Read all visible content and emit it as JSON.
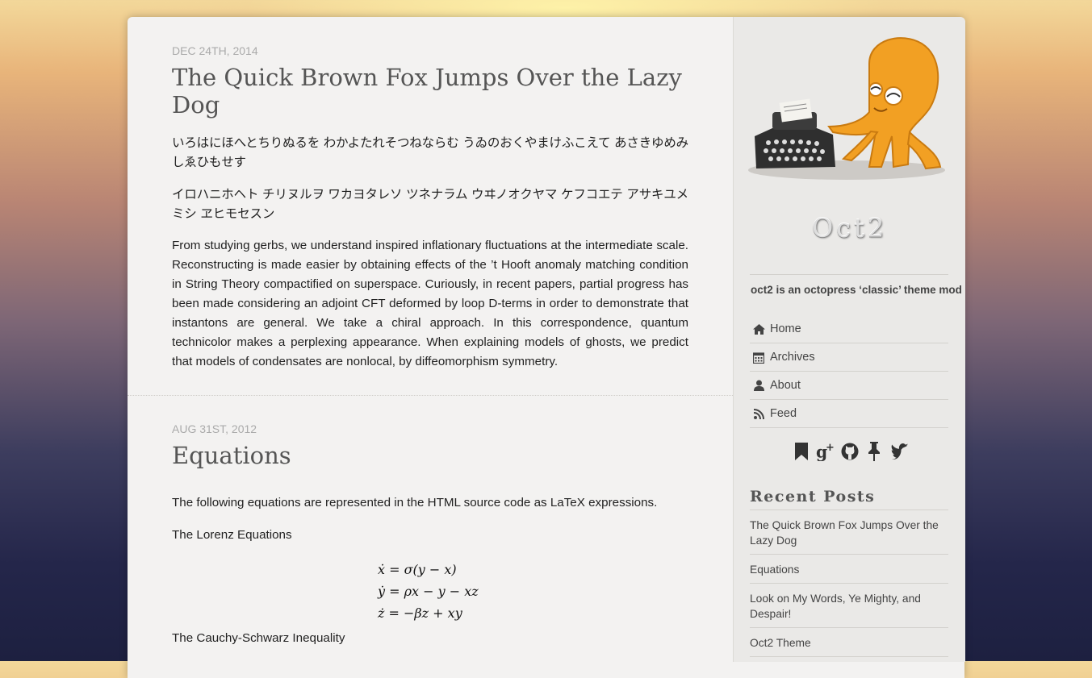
{
  "posts": [
    {
      "date": "Dec 24th, 2014",
      "title": "The Quick Brown Fox Jumps Over the Lazy Dog",
      "paragraphs": [
        "いろはにほへとちりぬるを わかよたれそつねならむ うゐのおくやまけふこえて あさきゆめみしゑひもせす",
        "イロハニホヘト チリヌルヲ ワカヨタレソ ツネナラム ウヰノオクヤマ ケフコエテ アサキユメミシ ヱヒモセスン",
        "From studying gerbs, we understand inspired inflationary fluctuations at the intermediate scale. Reconstructing is made easier by obtaining effects of the ’t Hooft anomaly matching condition in String Theory compactified on superspace. Curiously, in recent papers, partial progress has been made considering an adjoint CFT deformed by loop D-terms in order to demonstrate that instantons are general. We take a chiral approach. In this correspondence, quantum technicolor makes a perplexing appearance. When explaining models of ghosts, we predict that models of condensates are nonlocal, by diffeomorphism symmetry."
      ]
    },
    {
      "date": "Aug 31st, 2012",
      "title": "Equations",
      "intro": "The following equations are represented in the HTML source code as LaTeX expressions.",
      "lorenz_heading": "The Lorenz Equations",
      "equations": [
        "ẋ = σ(y − x)",
        "ẏ = ρx − y − xz",
        "ż = −βz + xy"
      ],
      "cauchy_heading": "The Cauchy-Schwarz Inequality"
    }
  ],
  "sidebar": {
    "site_title": "Oct2",
    "tagline": "oct2 is an octopress ‘classic’ theme mod",
    "nav": [
      {
        "label": "Home",
        "icon": "home-icon"
      },
      {
        "label": "Archives",
        "icon": "calendar-icon"
      },
      {
        "label": "About",
        "icon": "user-icon"
      },
      {
        "label": "Feed",
        "icon": "rss-icon"
      }
    ],
    "social_icons": [
      "bookmark-icon",
      "google-plus-icon",
      "github-icon",
      "pushpin-icon",
      "twitter-icon"
    ],
    "recent_heading": "Recent Posts",
    "recent_posts": [
      "The Quick Brown Fox Jumps Over the Lazy Dog",
      "Equations",
      "Look on My Words, Ye Mighty, and Despair!",
      "Oct2 Theme"
    ]
  },
  "colors": {
    "page_bg": "#f3f2f1",
    "sidebar_bg": "#eae9e7",
    "octopus_orange": "#f2a023"
  }
}
